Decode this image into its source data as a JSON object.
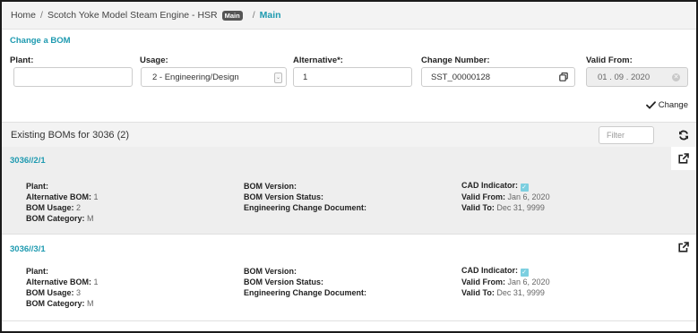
{
  "breadcrumb": {
    "home": "Home",
    "sep": "/",
    "engine": "Scotch Yoke Model Steam Engine - HSR",
    "tag": "Main",
    "current": "Main"
  },
  "change_section": {
    "title": "Change a BOM",
    "change_label": "Change"
  },
  "fields": {
    "plant": {
      "label": "Plant:",
      "value": ""
    },
    "usage": {
      "label": "Usage:",
      "value": "2 - Engineering/Design"
    },
    "alternative": {
      "label": "Alternative*:",
      "value": "1"
    },
    "change_number": {
      "label": "Change Number:",
      "value": "SST_00000128"
    },
    "valid_from": {
      "label": "Valid From:",
      "value": "01 . 09 . 2020"
    }
  },
  "existing": {
    "title": "Existing BOMs for 3036 (2)",
    "filter_placeholder": "Filter"
  },
  "labels": {
    "plant": "Plant:",
    "alternative_bom": "Alternative BOM:",
    "bom_usage": "BOM Usage:",
    "bom_category": "BOM Category:",
    "bom_version": "BOM Version:",
    "bom_version_status": "BOM Version Status:",
    "engineering_change_document": "Engineering Change Document:",
    "cad_indicator": "CAD Indicator:",
    "valid_from": "Valid From:",
    "valid_to": "Valid To:"
  },
  "boms": [
    {
      "id": "3036//2/1",
      "alternative_bom": "1",
      "bom_usage": "2",
      "bom_category": "M",
      "valid_from": "Jan 6, 2020",
      "valid_to": "Dec 31, 9999"
    },
    {
      "id": "3036//3/1",
      "alternative_bom": "1",
      "bom_usage": "3",
      "bom_category": "M",
      "valid_from": "Jan 6, 2020",
      "valid_to": "Dec 31, 9999"
    }
  ],
  "colors": {
    "accent": "#1e9ab0",
    "checkbox": "#7ccfe0"
  }
}
